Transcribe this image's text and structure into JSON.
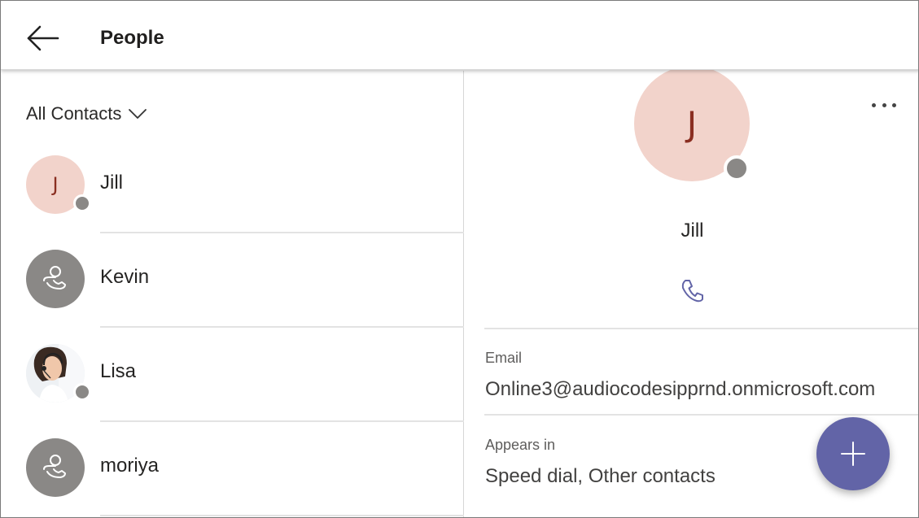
{
  "header": {
    "title": "People",
    "back_icon": "arrow-left-icon"
  },
  "filter": {
    "label": "All Contacts",
    "icon": "chevron-down-icon"
  },
  "contacts": [
    {
      "name": "Jill",
      "avatar_type": "initial",
      "initial": "J",
      "presence": "offline"
    },
    {
      "name": "Kevin",
      "avatar_type": "generic",
      "presence": "none"
    },
    {
      "name": "Lisa",
      "avatar_type": "photo",
      "presence": "offline"
    },
    {
      "name": "moriya",
      "avatar_type": "generic",
      "presence": "none"
    }
  ],
  "detail": {
    "initial": "J",
    "name": "Jill",
    "more_icon": "more-horizontal-icon",
    "call_icon": "phone-icon",
    "email_label": "Email",
    "email_value": "Online3@audiocodesipprnd.onmicrosoft.com",
    "appears_label": "Appears in",
    "appears_value": "Speed dial, Other contacts"
  },
  "fab": {
    "icon": "plus-icon"
  },
  "colors": {
    "accent": "#6264a7",
    "avatar_pink": "#f2d3cb",
    "initial_text": "#8a2e21",
    "presence_gray": "#8a8886",
    "divider": "#e3e3e3"
  }
}
